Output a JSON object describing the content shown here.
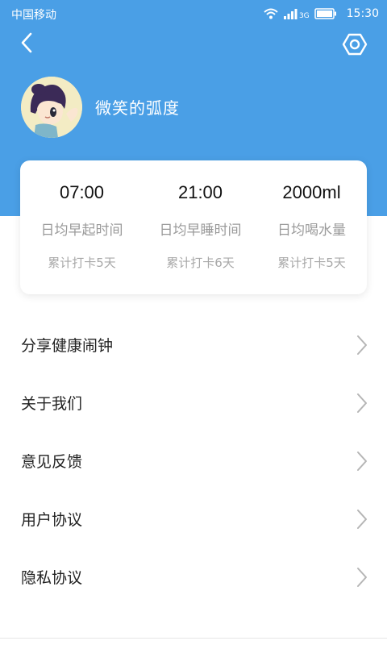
{
  "status_bar": {
    "carrier": "中国移动",
    "network": "3G",
    "time": "15:30"
  },
  "nav": {
    "back_icon": "chevron-left-icon",
    "settings_icon": "hexagon-settings-icon"
  },
  "profile": {
    "username": "微笑的弧度"
  },
  "stats": [
    {
      "value": "07:00",
      "label": "日均早起时间",
      "streak": "累计打卡5天"
    },
    {
      "value": "21:00",
      "label": "日均早睡时间",
      "streak": "累计打卡6天"
    },
    {
      "value": "2000ml",
      "label": "日均喝水量",
      "streak": "累计打卡5天"
    }
  ],
  "menu": [
    {
      "label": "分享健康闹钟"
    },
    {
      "label": "关于我们"
    },
    {
      "label": "意见反馈"
    },
    {
      "label": "用户协议"
    },
    {
      "label": "隐私协议"
    }
  ],
  "colors": {
    "primary": "#4a9fe6",
    "card_bg": "#ffffff",
    "muted_text": "#9a9a9a"
  }
}
